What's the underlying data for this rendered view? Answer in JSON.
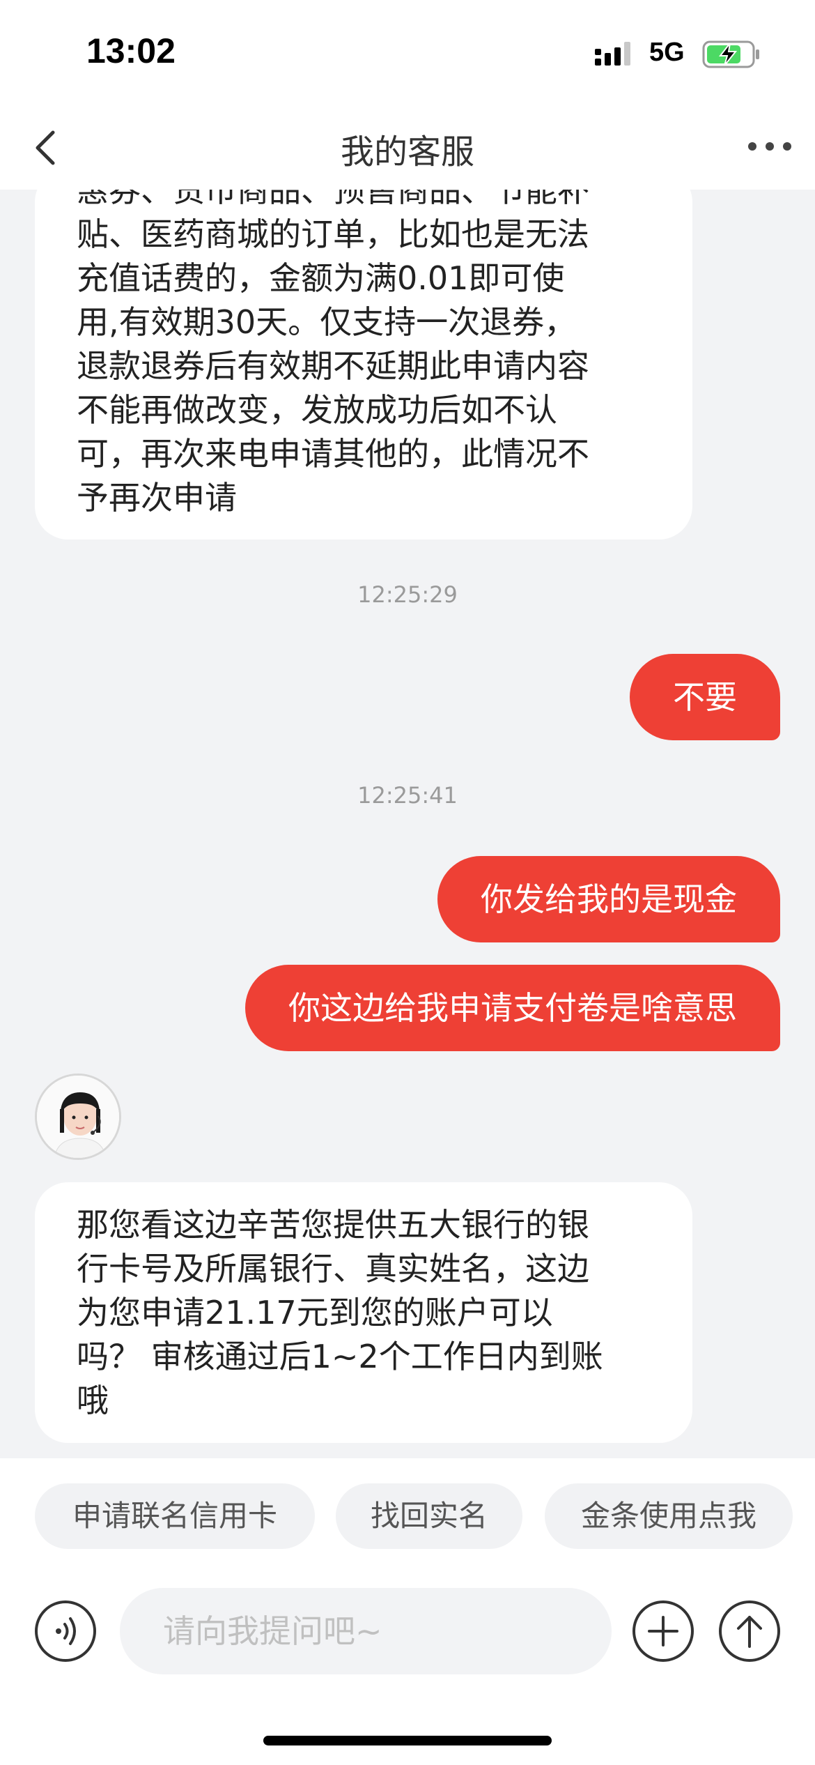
{
  "status_bar": {
    "time": "13:02",
    "network": "5G"
  },
  "nav": {
    "title": "我的客服"
  },
  "chat": {
    "agent_message_1_lines": [
      "惠券、货币商品、预售商品、节能补",
      "贴、医药商城的订单，比如也是无法",
      "充值话费的，金额为满0.01即可使",
      "用,有效期30天。仅支持一次退券，",
      "退款退券后有效期不延期此申请内容",
      "不能再做改变，发放成功后如不认",
      "可，再次来电申请其他的，此情况不",
      "予再次申请"
    ],
    "time_1": "12:25:29",
    "user_message_1": "不要",
    "time_2": "12:25:41",
    "user_message_2": "你发给我的是现金",
    "user_message_3": "你这边给我申请支付卷是啥意思",
    "agent_message_2_lines": [
      "那您看这边辛苦您提供五大银行的银",
      "行卡号及所属银行、真实姓名，这边",
      "为您申请21.17元到您的账户可以",
      "吗？ 审核通过后1~2个工作日内到账",
      "哦"
    ]
  },
  "quick_replies": [
    "申请联名信用卡",
    "找回实名",
    "金条使用点我"
  ],
  "input": {
    "placeholder": "请向我提问吧~"
  },
  "icons": {
    "back": "chevron-left-icon",
    "more": "more-dots-icon",
    "voice": "voice-icon",
    "plus": "plus-icon",
    "send": "arrow-up-icon"
  },
  "colors": {
    "accent": "#ee4035",
    "battery": "#4cd964"
  }
}
